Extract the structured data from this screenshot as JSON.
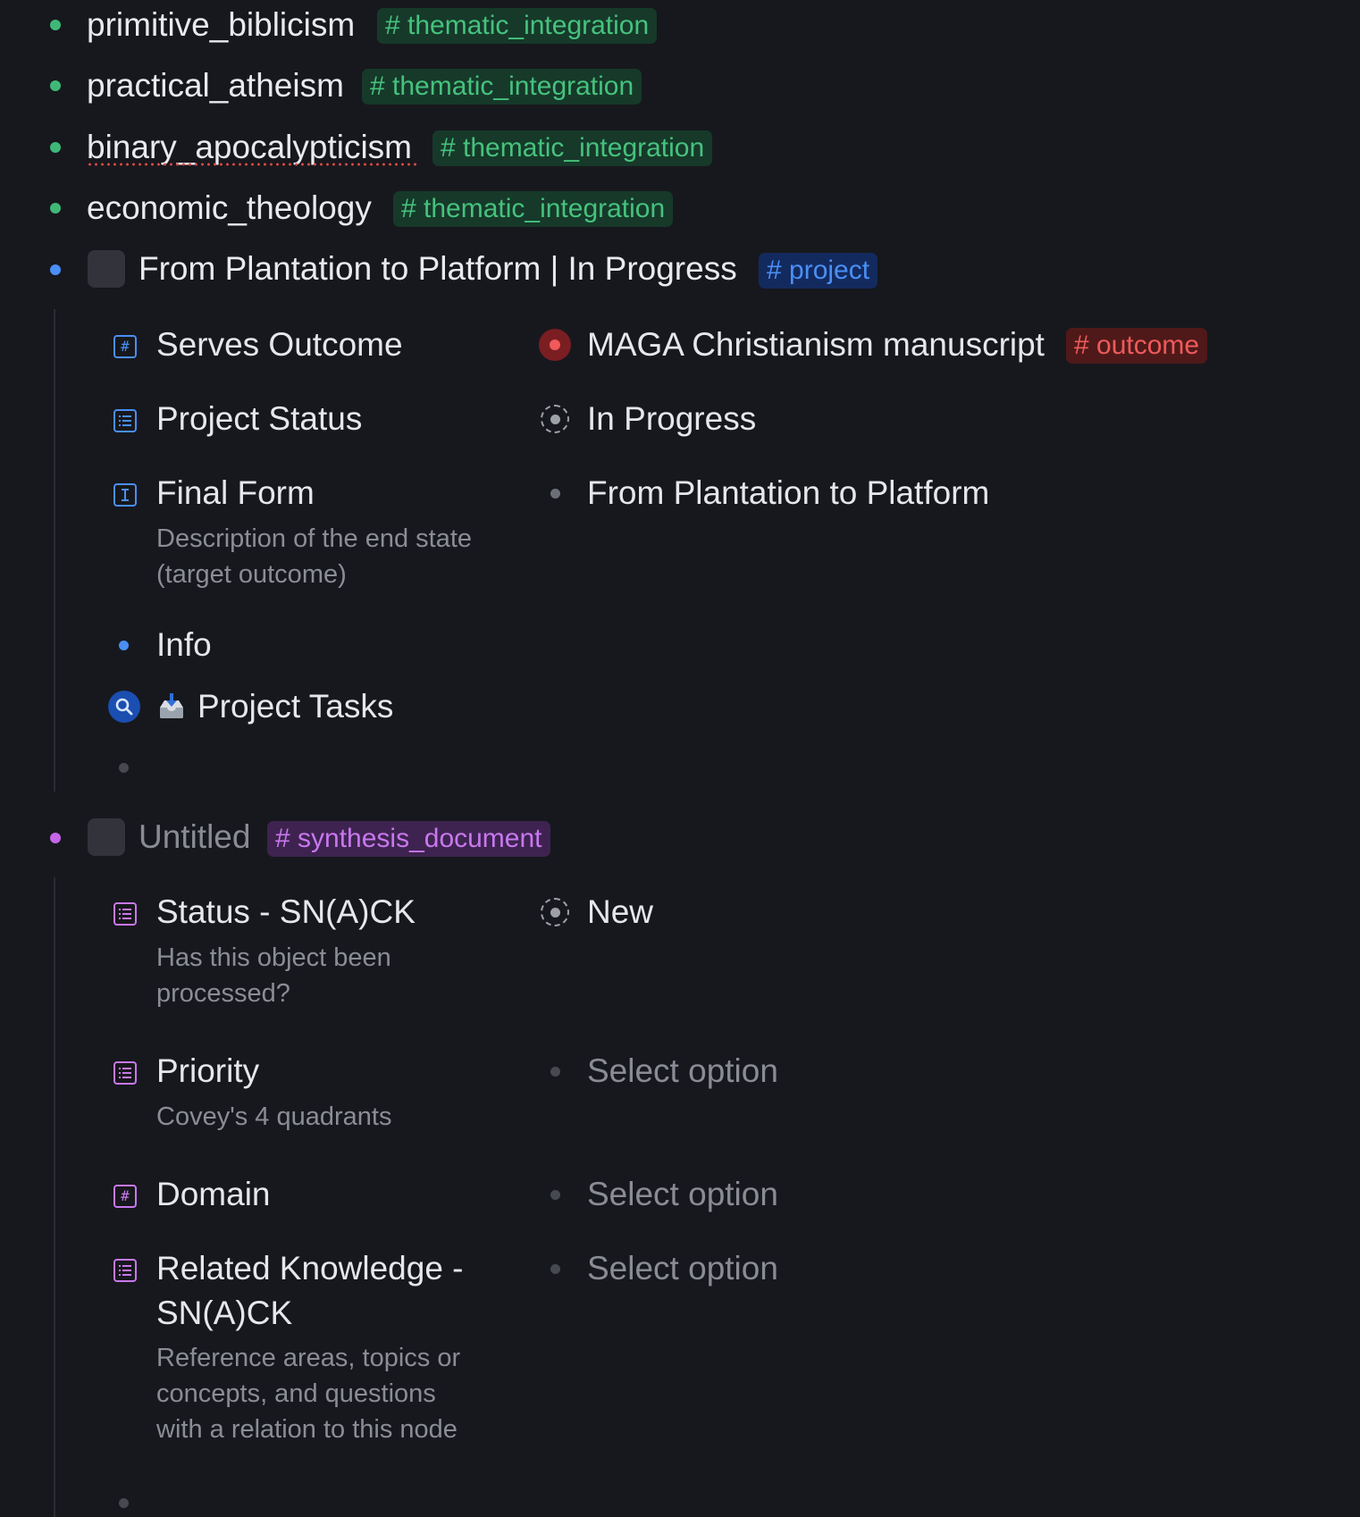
{
  "colors": {
    "background": "#17181d",
    "green_tag": "#46c27d",
    "blue_tag": "#4a8ff5",
    "red_tag": "#f05a5a",
    "purple_tag": "#c878ee"
  },
  "top_items": [
    {
      "label": "primitive_biblicism",
      "tag": "# thematic_integration",
      "bullet_color": "#3fb877"
    },
    {
      "label": "practical_atheism",
      "tag": "# thematic_integration",
      "bullet_color": "#3fb877"
    },
    {
      "label": "binary_apocalypticism",
      "tag": "# thematic_integration",
      "bullet_color": "#3fb877",
      "spellcheck_flag": true
    },
    {
      "label": "economic_theology",
      "tag": "# thematic_integration",
      "bullet_color": "#3fb877"
    }
  ],
  "project": {
    "title": "From Plantation to Platform | In Progress",
    "tag": "# project",
    "bullet_color": "#4a8ff5",
    "fields": {
      "serves_outcome": {
        "name": "Serves Outcome",
        "icon": "hash-field-icon",
        "value": "MAGA Christianism manuscript",
        "value_tag": "# outcome"
      },
      "project_status": {
        "name": "Project Status",
        "icon": "list-field-icon",
        "value": "In Progress"
      },
      "final_form": {
        "name": "Final Form",
        "icon": "text-field-icon",
        "description": "Description of the end state (target outcome)",
        "value": "From Plantation to Platform"
      }
    },
    "children": {
      "info": "Info",
      "tasks_emoji": "📥",
      "tasks": "Project Tasks"
    }
  },
  "synthesis": {
    "title": "Untitled",
    "tag": "# synthesis_document",
    "bullet_color": "#c566e8",
    "fields": {
      "status": {
        "name": "Status - SN(A)CK",
        "icon": "list-field-icon",
        "description": "Has this object been processed?",
        "value": "New"
      },
      "priority": {
        "name": "Priority",
        "icon": "list-field-icon",
        "description": "Covey's 4 quadrants",
        "value": "Select option"
      },
      "domain": {
        "name": "Domain",
        "icon": "hash-field-icon",
        "value": "Select option"
      },
      "related": {
        "name_line1": "Related Knowledge -",
        "name_line2": "SN(A)CK",
        "icon": "list-field-icon",
        "description": "Reference areas, topics or concepts, and questions with a relation to this node",
        "value": "Select option"
      }
    }
  }
}
